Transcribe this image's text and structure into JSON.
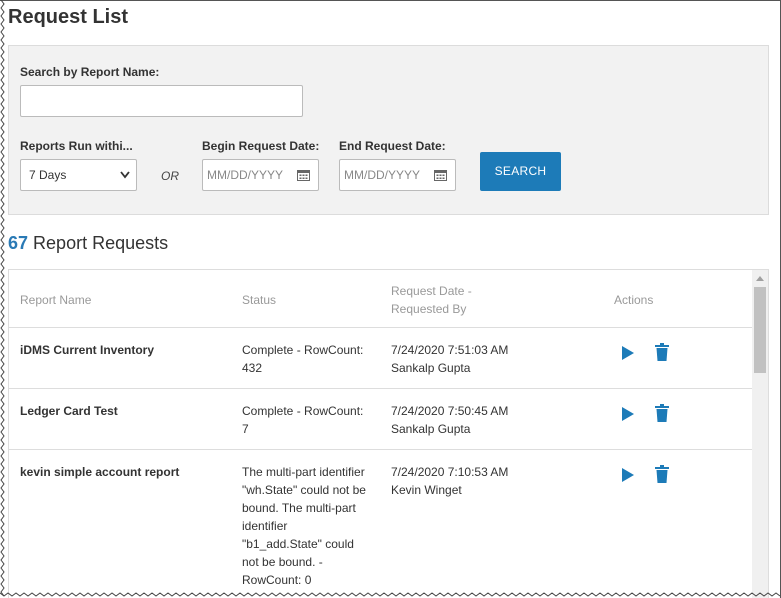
{
  "page": {
    "title": "Request List"
  },
  "filters": {
    "search_label": "Search by Report Name:",
    "search_value": "",
    "run_within_label": "Reports Run withi...",
    "run_within_value": "7 Days",
    "or_label": "OR",
    "begin_label": "Begin Request Date:",
    "begin_placeholder": "MM/DD/YYYY",
    "end_label": "End Request Date:",
    "end_placeholder": "MM/DD/YYYY",
    "search_button": "SEARCH"
  },
  "summary": {
    "count": "67",
    "label": "Report Requests"
  },
  "table": {
    "headers": {
      "name": "Report Name",
      "status": "Status",
      "date_line1": "Request Date -",
      "date_line2": "Requested By",
      "actions": "Actions"
    },
    "rows": [
      {
        "name": "iDMS Current Inventory",
        "status": [
          "Complete - RowCount:",
          "432"
        ],
        "date": "7/24/2020 7:51:03 AM",
        "by": "Sankalp Gupta"
      },
      {
        "name": "Ledger Card Test",
        "status": [
          "Complete - RowCount:",
          "7"
        ],
        "date": "7/24/2020 7:50:45 AM",
        "by": "Sankalp Gupta"
      },
      {
        "name": "kevin simple account report",
        "status": [
          "The multi-part identifier",
          "\"wh.State\" could not be",
          "bound. The multi-part",
          "identifier",
          "\"b1_add.State\" could",
          "not be bound. -",
          "RowCount: 0"
        ],
        "date": "7/24/2020 7:10:53 AM",
        "by": "Kevin Winget"
      }
    ]
  },
  "colors": {
    "accent": "#1d7bb8",
    "count": "#2a7ab5",
    "panel": "#f2f2f2"
  },
  "icons": {
    "play": "play-icon",
    "delete": "trash-icon",
    "calendar": "calendar-icon",
    "chevron": "chevron-down-icon"
  }
}
